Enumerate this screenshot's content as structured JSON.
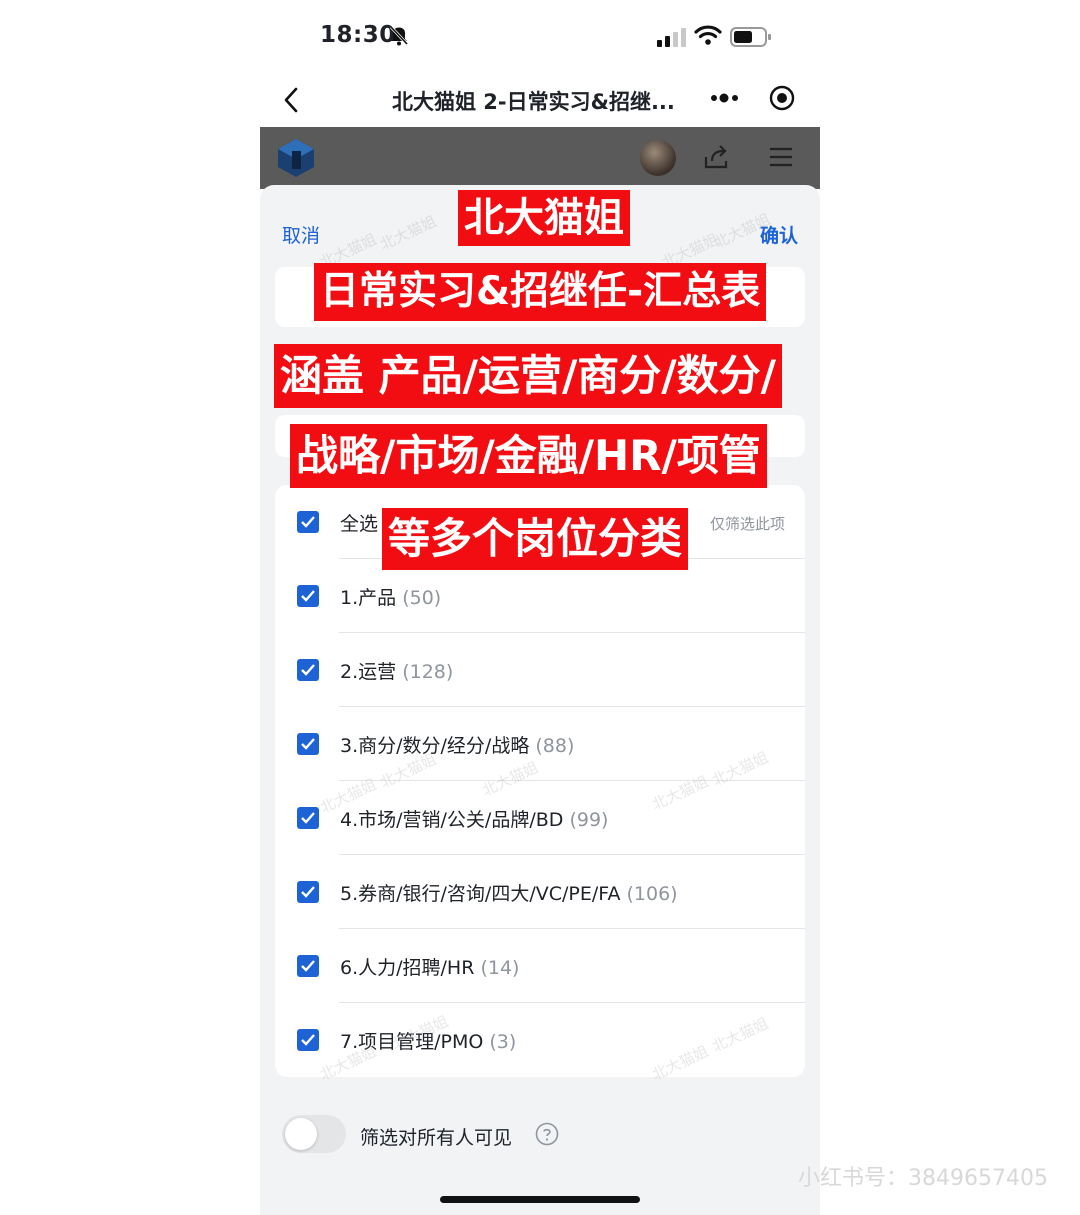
{
  "status_bar": {
    "time": "18:30"
  },
  "nav": {
    "title": "北大猫姐 2-日常实习&招继..."
  },
  "sheet": {
    "cancel_label": "取消",
    "confirm_label": "确认",
    "select_all_label": "全选",
    "only_filter_label": "仅筛选此项",
    "items": [
      {
        "label": "1.产品",
        "count": "(50)"
      },
      {
        "label": "2.运营",
        "count": "(128)"
      },
      {
        "label": "3.商分/数分/经分/战略",
        "count": "(88)"
      },
      {
        "label": "4.市场/营销/公关/品牌/BD",
        "count": "(99)"
      },
      {
        "label": "5.券商/银行/咨询/四大/VC/PE/FA",
        "count": "(106)"
      },
      {
        "label": "6.人力/招聘/HR",
        "count": "(14)"
      },
      {
        "label": "7.项目管理/PMO",
        "count": "(3)"
      }
    ],
    "all_checked": true,
    "toggle_label": "筛选对所有人可见",
    "toggle_on": false
  },
  "overlay": {
    "line1": "北大猫姐",
    "line2": "日常实习&招继任-汇总表",
    "line3": "涵盖 产品/运营/商分/数分/",
    "line4": "战略/市场/金融/HR/项管",
    "line5": "等多个岗位分类"
  },
  "watermark": {
    "text": "北大猫姐",
    "account": "小红书号：3849657405"
  },
  "colors": {
    "accent": "#1e63d6",
    "banner": "#f20d12",
    "sheet_bg": "#f2f3f5"
  },
  "icons": [
    "bell-slash-icon",
    "signal-icon",
    "wifi-icon",
    "battery-icon",
    "back-icon",
    "more-icon",
    "target-icon",
    "logo-icon",
    "share-icon",
    "menu-icon",
    "check-icon",
    "help-icon"
  ]
}
